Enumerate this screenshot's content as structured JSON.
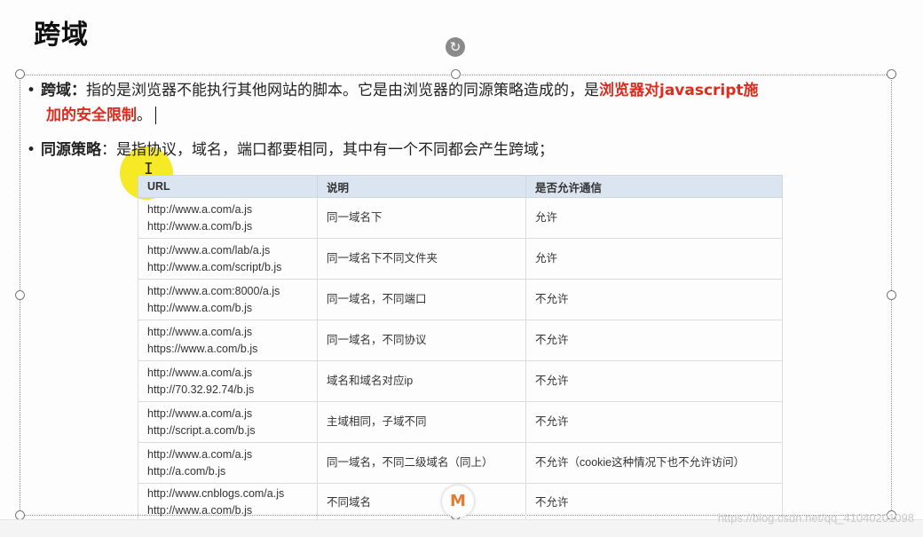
{
  "slide": {
    "title": "跨域",
    "bullets": [
      {
        "keyword": "跨域：",
        "text": "指的是浏览器不能执行其他网站的脚本。它是由浏览器的同源策略造成的，是",
        "highlight_part1": "浏览器对javascript施",
        "highlight_part2": "加的安全限制",
        "tail": "。"
      },
      {
        "keyword": "同源策略",
        "text": "：是指协议，域名，端口都要相同，其中有一个不同都会产生跨域；"
      }
    ],
    "bullet_symbol": "•",
    "rotate_icon": "↻"
  },
  "table": {
    "headers": [
      "URL",
      "说明",
      "是否允许通信"
    ],
    "rows": [
      {
        "url1": "http://www.a.com/a.js",
        "url2": "http://www.a.com/b.js",
        "desc": "同一域名下",
        "allowed": "允许"
      },
      {
        "url1": "http://www.a.com/lab/a.js",
        "url2": "http://www.a.com/script/b.js",
        "desc": "同一域名下不同文件夹",
        "allowed": "允许"
      },
      {
        "url1": "http://www.a.com:8000/a.js",
        "url2": "http://www.a.com/b.js",
        "desc": "同一域名，不同端口",
        "allowed": "不允许"
      },
      {
        "url1": "http://www.a.com/a.js",
        "url2": "https://www.a.com/b.js",
        "desc": "同一域名，不同协议",
        "allowed": "不允许"
      },
      {
        "url1": "http://www.a.com/a.js",
        "url2": "http://70.32.92.74/b.js",
        "desc": "域名和域名对应ip",
        "allowed": "不允许"
      },
      {
        "url1": "http://www.a.com/a.js",
        "url2": "http://script.a.com/b.js",
        "desc": "主域相同，子域不同",
        "allowed": "不允许"
      },
      {
        "url1": "http://www.a.com/a.js",
        "url2": "http://a.com/b.js",
        "desc": "同一域名，不同二级域名（同上）",
        "allowed": "不允许（cookie这种情况下也不允许访问）"
      },
      {
        "url1": "http://www.cnblogs.com/a.js",
        "url2": "http://www.a.com/b.js",
        "desc": "不同域名",
        "allowed": "不允许"
      }
    ]
  },
  "watermark": "https://blog.csdn.net/qq_41040201098",
  "logo_glyph": "M"
}
